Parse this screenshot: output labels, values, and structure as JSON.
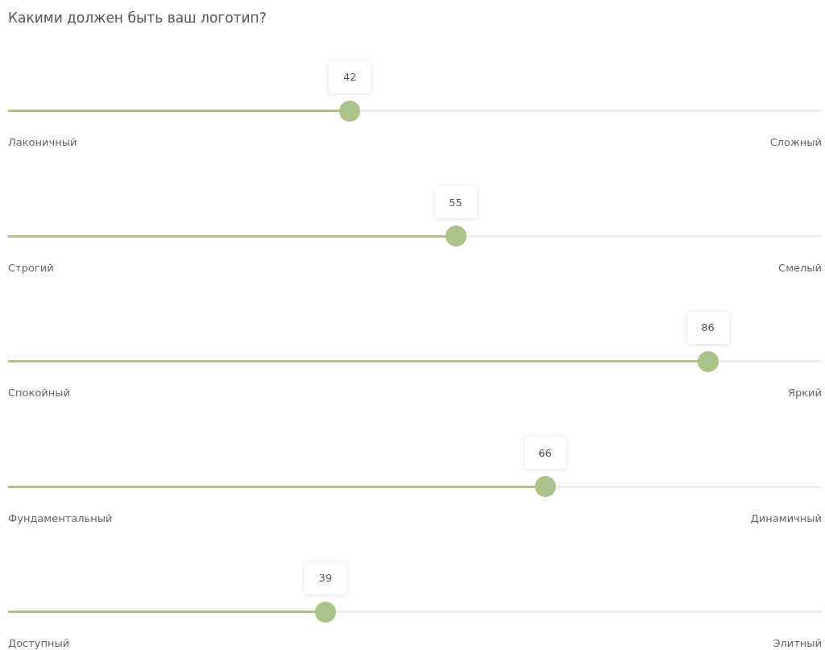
{
  "title": "Какими должен быть ваш логотип?",
  "sliders": [
    {
      "value": "42",
      "level": 0.42,
      "left_label": "Лаконичный",
      "right_label": "Сложный"
    },
    {
      "value": "55",
      "level": 0.55,
      "left_label": "Строгий",
      "right_label": "Смелый"
    },
    {
      "value": "86",
      "level": 0.86,
      "left_label": "Спокойный",
      "right_label": "Яркий"
    },
    {
      "value": "66",
      "level": 0.66,
      "left_label": "Фундаментальный",
      "right_label": "Динамичный"
    },
    {
      "value": "39",
      "level": 0.39,
      "left_label": "Доступный",
      "right_label": "Элитный"
    }
  ]
}
